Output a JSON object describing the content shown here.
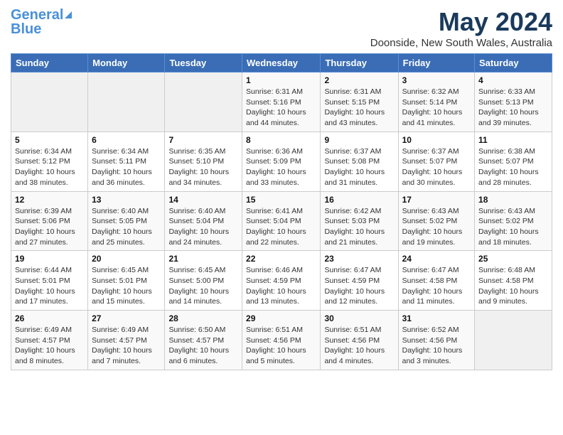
{
  "header": {
    "logo_line1": "General",
    "logo_line2": "Blue",
    "main_title": "May 2024",
    "subtitle": "Doonside, New South Wales, Australia"
  },
  "calendar": {
    "columns": [
      "Sunday",
      "Monday",
      "Tuesday",
      "Wednesday",
      "Thursday",
      "Friday",
      "Saturday"
    ],
    "weeks": [
      [
        {
          "day": "",
          "info": ""
        },
        {
          "day": "",
          "info": ""
        },
        {
          "day": "",
          "info": ""
        },
        {
          "day": "1",
          "info": "Sunrise: 6:31 AM\nSunset: 5:16 PM\nDaylight: 10 hours\nand 44 minutes."
        },
        {
          "day": "2",
          "info": "Sunrise: 6:31 AM\nSunset: 5:15 PM\nDaylight: 10 hours\nand 43 minutes."
        },
        {
          "day": "3",
          "info": "Sunrise: 6:32 AM\nSunset: 5:14 PM\nDaylight: 10 hours\nand 41 minutes."
        },
        {
          "day": "4",
          "info": "Sunrise: 6:33 AM\nSunset: 5:13 PM\nDaylight: 10 hours\nand 39 minutes."
        }
      ],
      [
        {
          "day": "5",
          "info": "Sunrise: 6:34 AM\nSunset: 5:12 PM\nDaylight: 10 hours\nand 38 minutes."
        },
        {
          "day": "6",
          "info": "Sunrise: 6:34 AM\nSunset: 5:11 PM\nDaylight: 10 hours\nand 36 minutes."
        },
        {
          "day": "7",
          "info": "Sunrise: 6:35 AM\nSunset: 5:10 PM\nDaylight: 10 hours\nand 34 minutes."
        },
        {
          "day": "8",
          "info": "Sunrise: 6:36 AM\nSunset: 5:09 PM\nDaylight: 10 hours\nand 33 minutes."
        },
        {
          "day": "9",
          "info": "Sunrise: 6:37 AM\nSunset: 5:08 PM\nDaylight: 10 hours\nand 31 minutes."
        },
        {
          "day": "10",
          "info": "Sunrise: 6:37 AM\nSunset: 5:07 PM\nDaylight: 10 hours\nand 30 minutes."
        },
        {
          "day": "11",
          "info": "Sunrise: 6:38 AM\nSunset: 5:07 PM\nDaylight: 10 hours\nand 28 minutes."
        }
      ],
      [
        {
          "day": "12",
          "info": "Sunrise: 6:39 AM\nSunset: 5:06 PM\nDaylight: 10 hours\nand 27 minutes."
        },
        {
          "day": "13",
          "info": "Sunrise: 6:40 AM\nSunset: 5:05 PM\nDaylight: 10 hours\nand 25 minutes."
        },
        {
          "day": "14",
          "info": "Sunrise: 6:40 AM\nSunset: 5:04 PM\nDaylight: 10 hours\nand 24 minutes."
        },
        {
          "day": "15",
          "info": "Sunrise: 6:41 AM\nSunset: 5:04 PM\nDaylight: 10 hours\nand 22 minutes."
        },
        {
          "day": "16",
          "info": "Sunrise: 6:42 AM\nSunset: 5:03 PM\nDaylight: 10 hours\nand 21 minutes."
        },
        {
          "day": "17",
          "info": "Sunrise: 6:43 AM\nSunset: 5:02 PM\nDaylight: 10 hours\nand 19 minutes."
        },
        {
          "day": "18",
          "info": "Sunrise: 6:43 AM\nSunset: 5:02 PM\nDaylight: 10 hours\nand 18 minutes."
        }
      ],
      [
        {
          "day": "19",
          "info": "Sunrise: 6:44 AM\nSunset: 5:01 PM\nDaylight: 10 hours\nand 17 minutes."
        },
        {
          "day": "20",
          "info": "Sunrise: 6:45 AM\nSunset: 5:01 PM\nDaylight: 10 hours\nand 15 minutes."
        },
        {
          "day": "21",
          "info": "Sunrise: 6:45 AM\nSunset: 5:00 PM\nDaylight: 10 hours\nand 14 minutes."
        },
        {
          "day": "22",
          "info": "Sunrise: 6:46 AM\nSunset: 4:59 PM\nDaylight: 10 hours\nand 13 minutes."
        },
        {
          "day": "23",
          "info": "Sunrise: 6:47 AM\nSunset: 4:59 PM\nDaylight: 10 hours\nand 12 minutes."
        },
        {
          "day": "24",
          "info": "Sunrise: 6:47 AM\nSunset: 4:58 PM\nDaylight: 10 hours\nand 11 minutes."
        },
        {
          "day": "25",
          "info": "Sunrise: 6:48 AM\nSunset: 4:58 PM\nDaylight: 10 hours\nand 9 minutes."
        }
      ],
      [
        {
          "day": "26",
          "info": "Sunrise: 6:49 AM\nSunset: 4:57 PM\nDaylight: 10 hours\nand 8 minutes."
        },
        {
          "day": "27",
          "info": "Sunrise: 6:49 AM\nSunset: 4:57 PM\nDaylight: 10 hours\nand 7 minutes."
        },
        {
          "day": "28",
          "info": "Sunrise: 6:50 AM\nSunset: 4:57 PM\nDaylight: 10 hours\nand 6 minutes."
        },
        {
          "day": "29",
          "info": "Sunrise: 6:51 AM\nSunset: 4:56 PM\nDaylight: 10 hours\nand 5 minutes."
        },
        {
          "day": "30",
          "info": "Sunrise: 6:51 AM\nSunset: 4:56 PM\nDaylight: 10 hours\nand 4 minutes."
        },
        {
          "day": "31",
          "info": "Sunrise: 6:52 AM\nSunset: 4:56 PM\nDaylight: 10 hours\nand 3 minutes."
        },
        {
          "day": "",
          "info": ""
        }
      ]
    ]
  }
}
